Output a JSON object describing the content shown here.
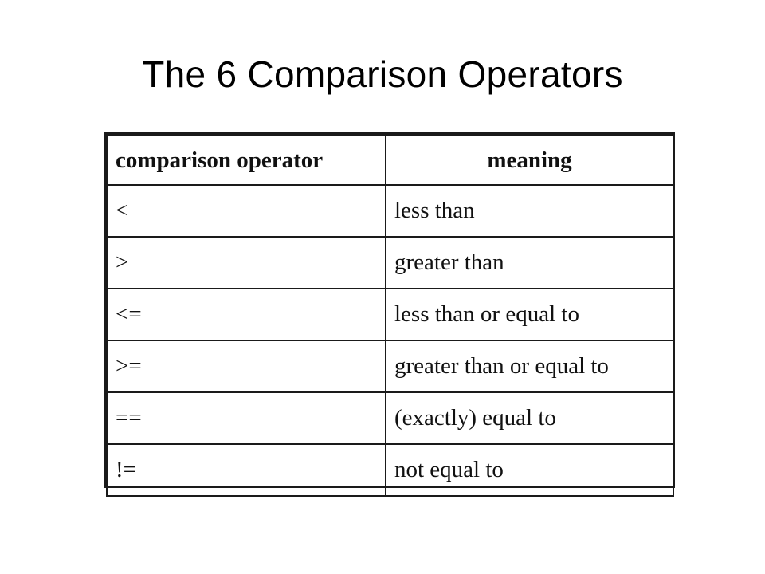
{
  "slide": {
    "title": "The 6 Comparison Operators"
  },
  "table": {
    "headers": {
      "operator": "comparison operator",
      "meaning": "meaning"
    },
    "rows": [
      {
        "operator": "<",
        "meaning": "less than"
      },
      {
        "operator": ">",
        "meaning": "greater than"
      },
      {
        "operator": "<=",
        "meaning": "less than or equal to"
      },
      {
        "operator": ">=",
        "meaning": "greater than or equal to"
      },
      {
        "operator": "==",
        "meaning": "(exactly) equal to"
      },
      {
        "operator": "!=",
        "meaning": "not equal to"
      }
    ]
  }
}
